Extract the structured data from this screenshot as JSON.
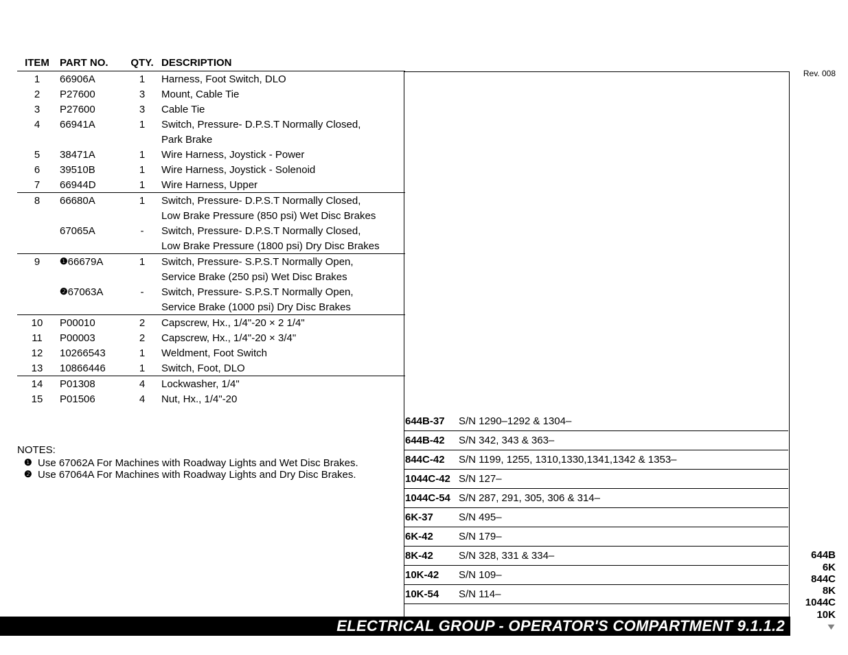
{
  "rev": "Rev. 008",
  "headers": {
    "item": "ITEM",
    "part": "PART NO.",
    "qty": "QTY.",
    "desc": "DESCRIPTION"
  },
  "rows": [
    {
      "item": "1",
      "part": "66906A",
      "qty": "1",
      "desc": "Harness, Foot Switch, DLO"
    },
    {
      "item": "2",
      "part": "P27600",
      "qty": "3",
      "desc": "Mount, Cable Tie"
    },
    {
      "item": "3",
      "part": "P27600",
      "qty": "3",
      "desc": "Cable Tie"
    },
    {
      "item": "4",
      "part": "66941A",
      "qty": "1",
      "desc": "Switch, Pressure- D.P.S.T Normally Closed,"
    },
    {
      "item": "",
      "part": "",
      "qty": "",
      "desc": "Park Brake"
    },
    {
      "item": "5",
      "part": "38471A",
      "qty": "1",
      "desc": "Wire Harness, Joystick - Power"
    },
    {
      "item": "6",
      "part": "39510B",
      "qty": "1",
      "desc": "Wire Harness, Joystick - Solenoid"
    },
    {
      "item": "7",
      "part": "66944D",
      "qty": "1",
      "desc": "Wire Harness, Upper",
      "hr": true
    },
    {
      "item": "8",
      "part": "66680A",
      "qty": "1",
      "desc": "Switch, Pressure- D.P.S.T Normally Closed,"
    },
    {
      "item": "",
      "part": "",
      "qty": "",
      "desc": "Low Brake Pressure (850 psi) Wet Disc Brakes"
    },
    {
      "item": "",
      "part": "67065A",
      "qty": "-",
      "desc": "Switch, Pressure- D.P.S.T Normally Closed,"
    },
    {
      "item": "",
      "part": "",
      "qty": "",
      "desc": "Low Brake Pressure (1800 psi) Dry Disc Brakes",
      "hr": true
    },
    {
      "item": "9",
      "sym": "❶",
      "part": "66679A",
      "qty": "1",
      "desc": "Switch, Pressure- S.P.S.T Normally Open,"
    },
    {
      "item": "",
      "part": "",
      "qty": "",
      "desc": "Service Brake (250 psi) Wet Disc Brakes"
    },
    {
      "item": "",
      "sym": "❷",
      "part": "67063A",
      "qty": "-",
      "desc": "Switch, Pressure- S.P.S.T Normally Open,"
    },
    {
      "item": "",
      "part": "",
      "qty": "",
      "desc": "Service Brake (1000 psi) Dry Disc Brakes",
      "hr": true
    },
    {
      "item": "10",
      "part": "P00010",
      "qty": "2",
      "desc": "Capscrew, Hx., 1/4\"-20 × 2 1/4\""
    },
    {
      "item": "11",
      "part": "P00003",
      "qty": "2",
      "desc": "Capscrew, Hx., 1/4\"-20 × 3/4\""
    },
    {
      "item": "12",
      "part": "10266543",
      "qty": "1",
      "desc": "Weldment, Foot Switch"
    },
    {
      "item": "13",
      "part": "10866446",
      "qty": "1",
      "desc": "Switch, Foot, DLO",
      "hr": true
    },
    {
      "item": "14",
      "part": "P01308",
      "qty": "4",
      "desc": "Lockwasher, 1/4\""
    },
    {
      "item": "15",
      "part": "P01506",
      "qty": "4",
      "desc": "Nut, Hx., 1/4\"-20"
    }
  ],
  "notesHeader": "NOTES:",
  "notes": [
    {
      "sym": "❶",
      "text": "Use 67062A For Machines with Roadway Lights and Wet Disc Brakes."
    },
    {
      "sym": "❷",
      "text": "Use 67064A For Machines with Roadway Lights and Dry Disc Brakes."
    }
  ],
  "serials": [
    {
      "m": "644B-37",
      "sn": "S/N 1290–1292 & 1304–"
    },
    {
      "m": "644B-42",
      "sn": "S/N 342, 343 & 363–"
    },
    {
      "m": "844C-42",
      "sn": "S/N 1199, 1255, 1310,1330,1341,1342 & 1353–"
    },
    {
      "m": "1044C-42",
      "sn": "S/N 127–"
    },
    {
      "m": "1044C-54",
      "sn": "S/N 287, 291, 305, 306 & 314–"
    },
    {
      "m": "6K-37",
      "sn": "S/N 495–"
    },
    {
      "m": "6K-42",
      "sn": "S/N 179–"
    },
    {
      "m": "8K-42",
      "sn": "S/N 328, 331 & 334–"
    },
    {
      "m": "10K-42",
      "sn": "S/N 109–"
    },
    {
      "m": "10K-54",
      "sn": "S/N 114–"
    }
  ],
  "modelsSide": [
    "644B",
    "6K",
    "844C",
    "8K",
    "1044C",
    "10K"
  ],
  "title": "ELECTRICAL GROUP - OPERATOR'S COMPARTMENT  9.1.1.2"
}
